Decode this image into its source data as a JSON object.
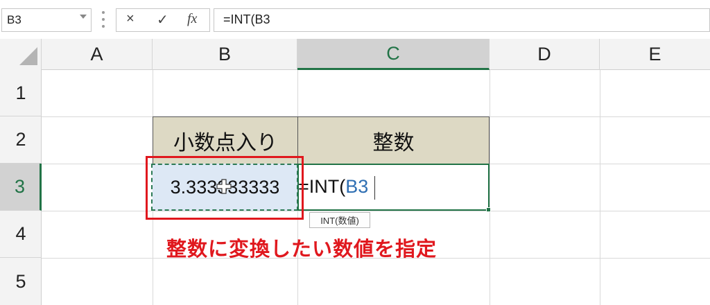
{
  "formula_bar": {
    "name_box": "B3",
    "cancel_icon": "×",
    "enter_icon": "✓",
    "fx_label": "fx",
    "formula": "=INT(B3"
  },
  "columns": [
    "A",
    "B",
    "C",
    "D",
    "E"
  ],
  "rows": [
    "1",
    "2",
    "3",
    "4",
    "5"
  ],
  "selected_column": "C",
  "selected_row": "3",
  "cells": {
    "b2": "小数点入り",
    "c2": "整数",
    "b3": "3.333333333",
    "c3_prefix": "=INT(",
    "c3_ref": "B3"
  },
  "tooltip": "INT(数値)",
  "annotation": "整数に変換したい数値を指定",
  "colors": {
    "accent": "#217346",
    "annotation": "#e0181e",
    "header_fill": "#ddd9c4",
    "reference": "#2f6fb3"
  }
}
